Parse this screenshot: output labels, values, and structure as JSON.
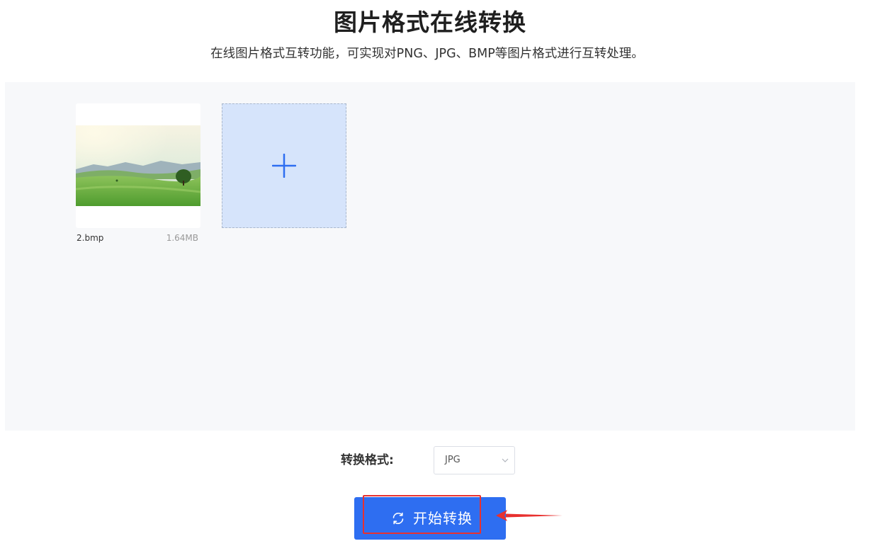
{
  "header": {
    "title": "图片格式在线转换",
    "subtitle": "在线图片格式互转功能，可实现对PNG、JPG、BMP等图片格式进行互转处理。"
  },
  "upload_area": {
    "files": [
      {
        "name": "2.bmp",
        "size": "1.64MB",
        "thumbnail_icon": "landscape-thumbnail"
      }
    ],
    "add_tile_icon": "plus-icon"
  },
  "conversion": {
    "format_label": "转换格式:",
    "format_value": "JPG",
    "dropdown_icon": "chevron-down-icon",
    "button_icon": "refresh-icon",
    "button_label": "开始转换"
  },
  "colors": {
    "accent": "#2e6ef1",
    "add_tile": "#d6e4fb",
    "workarea": "#f7f8fa",
    "annotation": "#e8312f"
  }
}
